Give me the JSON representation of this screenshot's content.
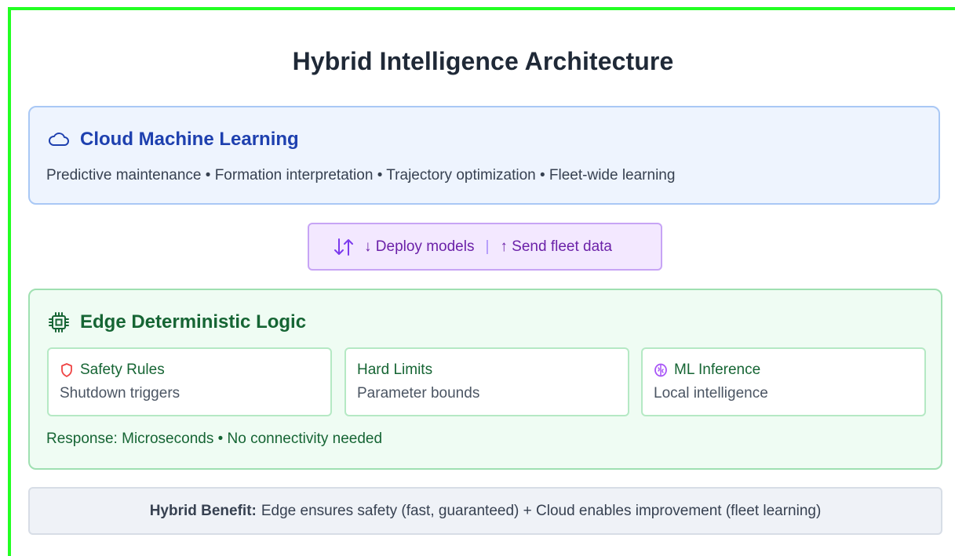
{
  "title": "Hybrid Intelligence Architecture",
  "cloud": {
    "title": "Cloud Machine Learning",
    "icon": "cloud-icon",
    "description": "Predictive maintenance • Formation interpretation • Trajectory optimization • Fleet-wide learning"
  },
  "flow": {
    "icon": "arrows-up-down-icon",
    "deploy": "↓ Deploy models",
    "separator": "|",
    "send": "↑ Send fleet data"
  },
  "edge": {
    "title": "Edge Deterministic Logic",
    "icon": "chip-icon",
    "cards": [
      {
        "title": "Safety Rules",
        "desc": "Shutdown triggers",
        "icon": "shield-icon"
      },
      {
        "title": "Hard Limits",
        "desc": "Parameter bounds",
        "icon": ""
      },
      {
        "title": "ML Inference",
        "desc": "Local intelligence",
        "icon": "brain-icon"
      }
    ],
    "footer": "Response: Microseconds • No connectivity needed"
  },
  "benefit": {
    "label": "Hybrid Benefit:",
    "text": "Edge ensures safety (fast, guaranteed) + Cloud enables improvement (fleet learning)"
  },
  "colors": {
    "frame": "#22ff22",
    "cloud_accent": "#1e40af",
    "edge_accent": "#166534",
    "flow_accent": "#6b21a8",
    "safety_icon": "#ef4444",
    "ml_icon": "#a855f7"
  }
}
